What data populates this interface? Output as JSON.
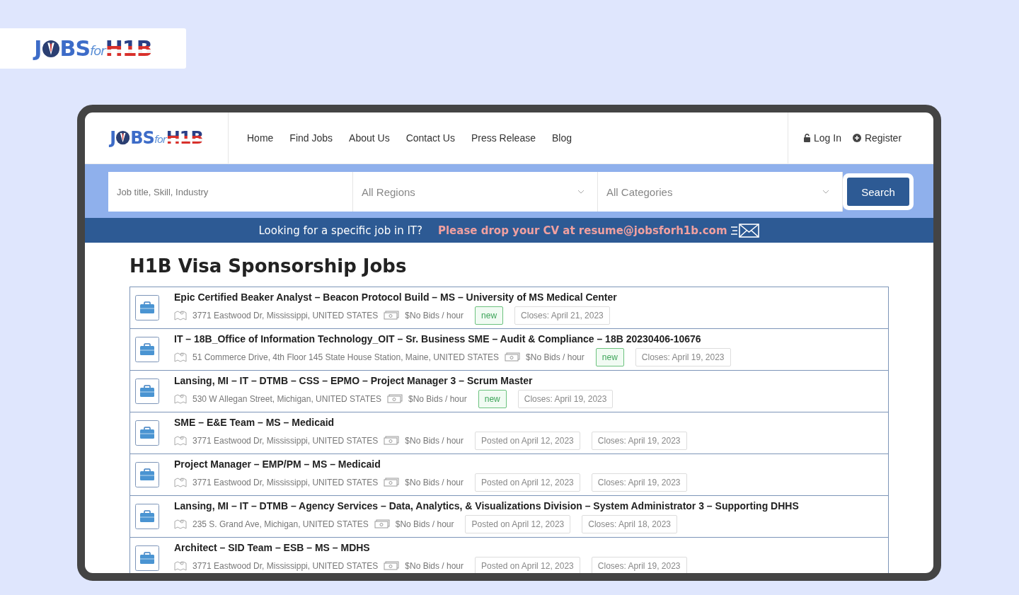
{
  "logo": {
    "parts": [
      "J",
      "BS",
      "for",
      "H1B"
    ]
  },
  "header": {
    "logo": {
      "parts": [
        "J",
        "BS",
        "for",
        "H1B"
      ]
    },
    "nav": [
      "Home",
      "Find Jobs",
      "About Us",
      "Contact Us",
      "Press Release",
      "Blog"
    ],
    "auth": [
      {
        "kind": "lock",
        "label": "Log In"
      },
      {
        "kind": "plus",
        "label": "Register"
      }
    ]
  },
  "search": {
    "keyword_placeholder": "Job title, Skill, Industry",
    "region": "All Regions",
    "category": "All Categories",
    "button": "Search"
  },
  "banner": {
    "question": "Looking for a specific job in IT?",
    "cta": "Please drop your CV at resume@jobsforh1b.com"
  },
  "heading": "H1B Visa Sponsorship Jobs",
  "jobs": [
    {
      "title": "Epic Certified Beaker Analyst – Beacon Protocol Build – MS – University of MS Medical Center",
      "address": "3771 Eastwood Dr, Mississippi, UNITED STATES",
      "rate": "$No Bids / hour",
      "tags": [
        {
          "kind": "new",
          "text": "new"
        },
        {
          "kind": "date",
          "text": "Closes: April 21, 2023"
        }
      ]
    },
    {
      "title": "IT – 18B_Office of Information Technology_OIT – Sr. Business SME – Audit & Compliance – 18B 20230406-10676",
      "address": "51 Commerce Drive, 4th Floor 145 State House Station, Maine, UNITED STATES",
      "rate": "$No Bids / hour",
      "tags": [
        {
          "kind": "new",
          "text": "new"
        },
        {
          "kind": "date",
          "text": "Closes: April 19, 2023"
        }
      ]
    },
    {
      "title": "Lansing, MI – IT – DTMB – CSS – EPMO – Project Manager 3 – Scrum Master",
      "address": "530 W Allegan Street, Michigan, UNITED STATES",
      "rate": "$No Bids / hour",
      "tags": [
        {
          "kind": "new",
          "text": "new"
        },
        {
          "kind": "date",
          "text": "Closes: April 19, 2023"
        }
      ]
    },
    {
      "title": "SME – E&E Team – MS – Medicaid",
      "address": "3771 Eastwood Dr, Mississippi, UNITED STATES",
      "rate": "$No Bids / hour",
      "tags": [
        {
          "kind": "date",
          "text": "Posted on April 12, 2023"
        },
        {
          "kind": "date",
          "text": "Closes: April 19, 2023"
        }
      ]
    },
    {
      "title": "Project Manager – EMP/PM – MS – Medicaid",
      "address": "3771 Eastwood Dr, Mississippi, UNITED STATES",
      "rate": "$No Bids / hour",
      "tags": [
        {
          "kind": "date",
          "text": "Posted on April 12, 2023"
        },
        {
          "kind": "date",
          "text": "Closes: April 19, 2023"
        }
      ]
    },
    {
      "title": "Lansing, MI – IT – DTMB – Agency Services – Data, Analytics, & Visualizations Division – System Administrator 3 – Supporting DHHS",
      "address": "235 S. Grand Ave, Michigan, UNITED STATES",
      "rate": "$No Bids / hour",
      "tags": [
        {
          "kind": "date",
          "text": "Posted on April 12, 2023"
        },
        {
          "kind": "date",
          "text": "Closes: April 18, 2023"
        }
      ]
    },
    {
      "title": "Architect – SID Team – ESB – MS – MDHS",
      "address": "3771 Eastwood Dr, Mississippi, UNITED STATES",
      "rate": "$No Bids / hour",
      "tags": [
        {
          "kind": "date",
          "text": "Posted on April 12, 2023"
        },
        {
          "kind": "date",
          "text": "Closes: April 19, 2023"
        }
      ]
    }
  ]
}
